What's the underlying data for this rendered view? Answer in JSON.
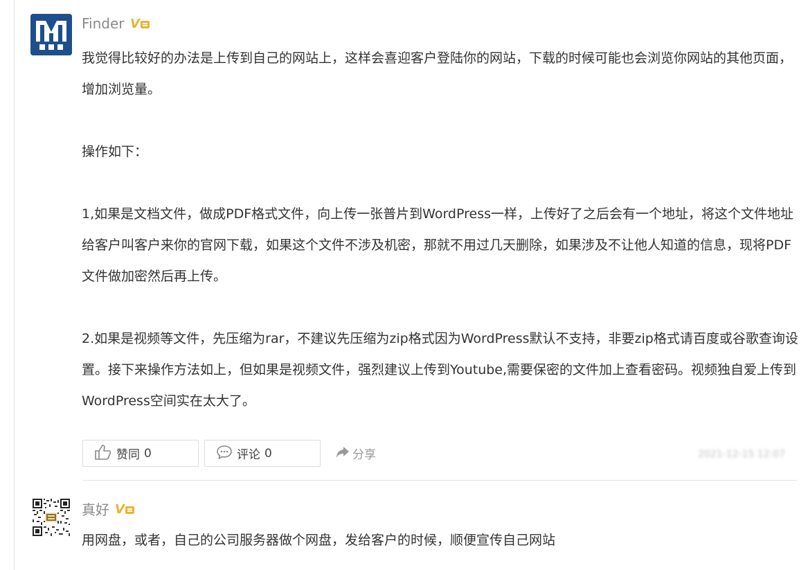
{
  "answer1": {
    "author": "Finder",
    "badge": "V",
    "paragraphs": [
      "我觉得比较好的办法是上传到自己的网站上，这样会喜迎客户登陆你的网站，下载的时候可能也会浏览你网站的其他页面，增加浏览量。",
      "操作如下：",
      "1,如果是文档文件，做成PDF格式文件，向上传一张普片到WordPress一样，上传好了之后会有一个地址，将这个文件地址给客户叫客户来你的官网下载，如果这个文件不涉及机密，那就不用过几天删除，如果涉及不让他人知道的信息，现将PDF文件做加密然后再上传。",
      "2.如果是视频等文件，先压缩为rar，不建议先压缩为zip格式因为WordPress默认不支持，非要zip格式请百度或谷歌查询设置。接下来操作方法如上，但如果是视频文件，强烈建议上传到Youtube,需要保密的文件加上查看密码。视频独自爱上传到WordPress空间实在太大了。"
    ],
    "actions": {
      "like_label": "赞同",
      "like_count": "0",
      "comment_label": "评论",
      "comment_count": "0",
      "share_label": "分享"
    },
    "timestamp": "2021-12-15 12:07"
  },
  "answer2": {
    "author": "真好",
    "badge": "V",
    "text": "用网盘，或者，自己的公司服务器做个网盘，发给客户的时候，顺便宣传自己网站"
  },
  "colors": {
    "badge": "#e8b430",
    "avatar_bg": "#1e4f8c"
  }
}
